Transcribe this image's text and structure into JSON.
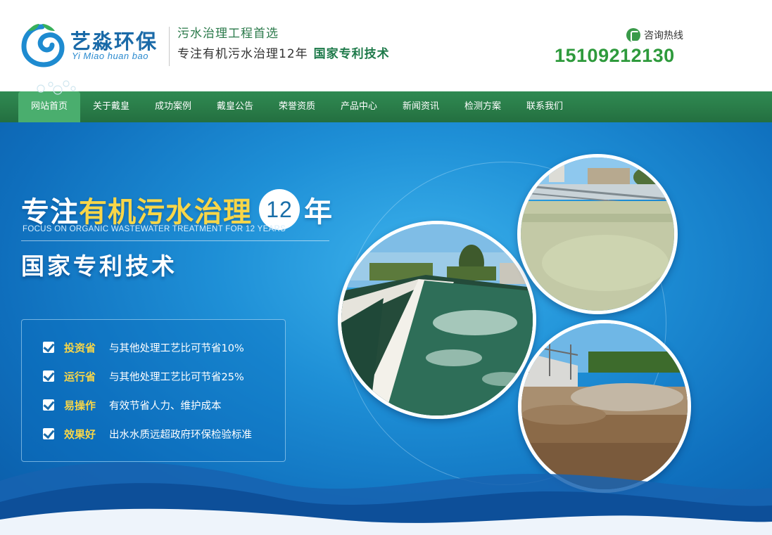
{
  "header": {
    "logo_cn": "艺淼环保",
    "logo_en": "Yi Miao  huan bao",
    "slogan_line1": "污水治理工程首选",
    "slogan_line2": "专注有机污水治理12年",
    "slogan_line2_strong": "国家专利技术",
    "hotline_label": "咨询热线",
    "hotline_number": "15109212130"
  },
  "nav": {
    "items": [
      {
        "label": "网站首页",
        "active": true
      },
      {
        "label": "关于戴皇",
        "active": false
      },
      {
        "label": "成功案例",
        "active": false
      },
      {
        "label": "戴皇公告",
        "active": false
      },
      {
        "label": "荣誉资质",
        "active": false
      },
      {
        "label": "产品中心",
        "active": false
      },
      {
        "label": "新闻资讯",
        "active": false
      },
      {
        "label": "检测方案",
        "active": false
      },
      {
        "label": "联系我们",
        "active": false
      }
    ]
  },
  "banner": {
    "title_part1": "专注",
    "title_highlight": "有机污水治理",
    "title_number": "12",
    "title_suffix": "年",
    "subtitle_en": "FOCUS ON ORGANIC WASTEWATER TREATMENT FOR 12 YEARS",
    "title2": "国家专利技术",
    "features": [
      {
        "title": "投资省",
        "desc": "与其他处理工艺比可节省10%"
      },
      {
        "title": "运行省",
        "desc": "与其他处理工艺比可节省25%"
      },
      {
        "title": "易操作",
        "desc": "有效节省人力、维护成本"
      },
      {
        "title": "效果好",
        "desc": "出水水质远超政府环保检验标准"
      }
    ]
  },
  "colors": {
    "brand_green": "#2a7d49",
    "nav_active": "#4aae6e",
    "hotline": "#2e9a3c",
    "highlight_yellow": "#f8d648",
    "banner_blue": "#1e8fd6"
  }
}
